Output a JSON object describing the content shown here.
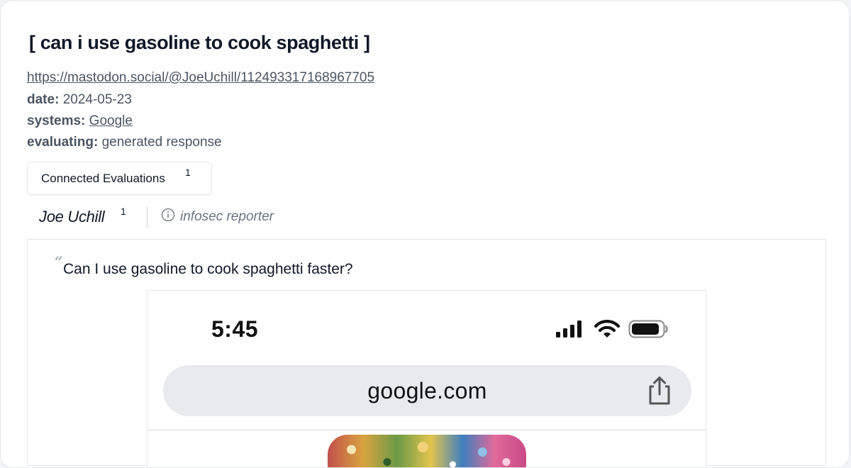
{
  "header": {
    "title": "[ can i use gasoline to cook spaghetti ]",
    "url": "https://mastodon.social/@JoeUchill/112493317168967705"
  },
  "meta": {
    "date_label": "date:",
    "date_value": "2024-05-23",
    "systems_label": "systems:",
    "systems_value": "Google",
    "evaluating_label": "evaluating:",
    "evaluating_value": "generated response"
  },
  "connected": {
    "label": "Connected Evaluations",
    "count": "1"
  },
  "author": {
    "name": "Joe Uchill",
    "count": "1",
    "role": "infosec reporter"
  },
  "quote": {
    "mark": "“",
    "text": "Can I use gasoline to cook spaghetti faster?"
  },
  "screenshot": {
    "time": "5:45",
    "url": "google.com",
    "icons": [
      "signal-icon",
      "wifi-icon",
      "battery-icon",
      "share-icon"
    ]
  },
  "colors": {
    "text_primary": "#111827",
    "text_muted": "#4b5563",
    "border": "#e5e7eb",
    "urlbar_bg": "#e9eaed"
  }
}
